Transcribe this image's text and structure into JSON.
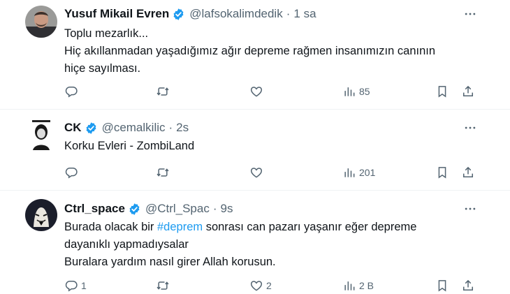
{
  "tweets": [
    {
      "author": {
        "name": "Yusuf Mikail Evren",
        "handle": "@lafsokalimdedik",
        "time": "1 sa"
      },
      "lines": [
        "Toplu mezarlık...",
        "Hiç akıllanmadan yaşadığımız ağır depreme rağmen insanımızın canının",
        "hiçe sayılması."
      ],
      "stats": {
        "replies": "",
        "reposts": "",
        "likes": "",
        "views": "85"
      }
    },
    {
      "author": {
        "name": "CK",
        "handle": "@cemalkilic",
        "time": "2s"
      },
      "lines": [
        "Korku Evleri - ZombiLand"
      ],
      "stats": {
        "replies": "",
        "reposts": "",
        "likes": "",
        "views": "201"
      }
    },
    {
      "author": {
        "name": "Ctrl_space",
        "handle": "@Ctrl_Spac",
        "time": "9s"
      },
      "line1": {
        "before": "Burada olacak bir ",
        "hashtag": "#deprem",
        "after": " sonrası can pazarı yaşanır eğer depreme"
      },
      "lines": [
        "dayanıklı yapmadıysalar",
        "Buralara yardım nasıl girer Allah korusun."
      ],
      "stats": {
        "replies": "1",
        "reposts": "",
        "likes": "2",
        "views": "2 B"
      }
    }
  ],
  "colors": {
    "text": "#0f1419",
    "secondary": "#536471",
    "link": "#1d9bf0",
    "verified": "#1d9bf0",
    "divider": "#eff3f4"
  },
  "icons": [
    "verified-badge-icon",
    "more-icon",
    "reply-icon",
    "repost-icon",
    "like-icon",
    "views-icon",
    "bookmark-icon",
    "share-icon"
  ]
}
